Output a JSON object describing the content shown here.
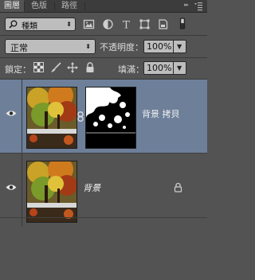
{
  "tabs": [
    {
      "label": "圖層",
      "active": true
    },
    {
      "label": "色版",
      "active": false
    },
    {
      "label": "路徑",
      "active": false
    }
  ],
  "filter": {
    "kind_label": "種類",
    "icons": [
      "image-filter-icon",
      "adjustment-filter-icon",
      "type-filter-icon",
      "shape-filter-icon",
      "smart-object-filter-icon"
    ]
  },
  "blend": {
    "mode": "正常",
    "opacity_label": "不透明度：",
    "opacity_value": "100%"
  },
  "lock": {
    "label": "鎖定：",
    "icons": [
      "lock-transparent-icon",
      "lock-image-icon",
      "lock-position-icon",
      "lock-all-icon"
    ],
    "fill_label": "填滿：",
    "fill_value": "100%"
  },
  "layers": [
    {
      "name": "背景 拷貝",
      "visible": true,
      "selected": true,
      "has_mask": true
    },
    {
      "name": "背景",
      "visible": true,
      "selected": false,
      "locked": true,
      "italic": true
    }
  ],
  "colors": {
    "panel_bg": "#535353",
    "selected_layer": "#6d7f99",
    "tab_bar": "#3c3c3c"
  }
}
